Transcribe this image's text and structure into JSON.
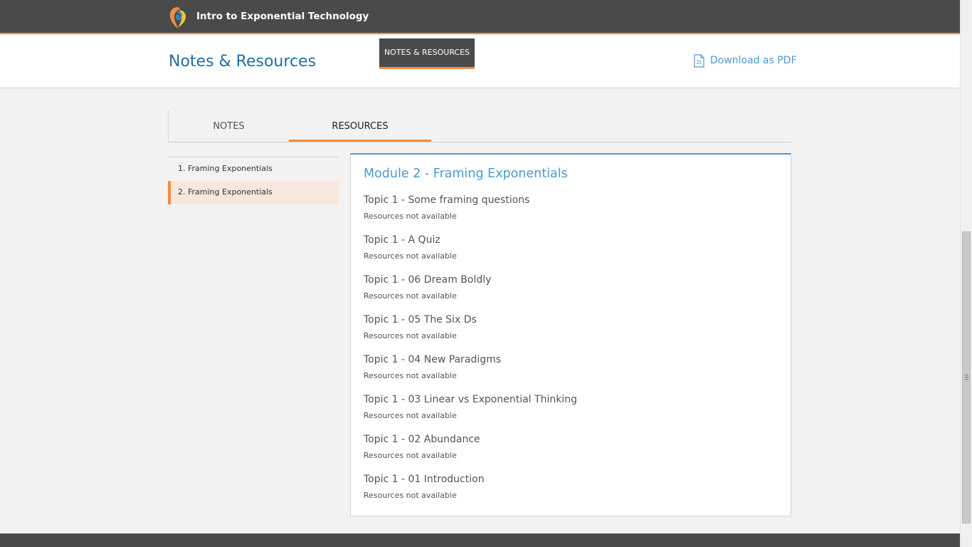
{
  "topbar": {
    "course_title": "Intro to Exponential Technology",
    "logo_icon": "brand-logo-icon",
    "accent_color": "#ef8d45",
    "bar_color": "#4a4a4a"
  },
  "header": {
    "page_title": "Notes & Resources",
    "nav_tab_label": "NOTES & RESOURCES",
    "download_label": "Download as PDF",
    "download_icon": "pdf-file-icon"
  },
  "tabs": [
    {
      "label": "NOTES",
      "active": false
    },
    {
      "label": "RESOURCES",
      "active": true
    }
  ],
  "sidebar": {
    "items": [
      {
        "label": "1. Framing Exponentials",
        "active": false
      },
      {
        "label": "2. Framing Exponentials",
        "active": true
      }
    ]
  },
  "panel": {
    "module_title": "Module 2 - Framing Exponentials",
    "topics": [
      {
        "title": "Topic 1 - Some framing questions",
        "status": "Resources not available"
      },
      {
        "title": "Topic 1 - A Quiz",
        "status": "Resources not available"
      },
      {
        "title": "Topic 1 - 06 Dream Boldly",
        "status": "Resources not available"
      },
      {
        "title": "Topic 1 - 05 The Six Ds",
        "status": "Resources not available"
      },
      {
        "title": "Topic 1 - 04 New Paradigms",
        "status": "Resources not available"
      },
      {
        "title": "Topic 1 - 03 Linear vs Exponential Thinking",
        "status": "Resources not available"
      },
      {
        "title": "Topic 1 - 02 Abundance",
        "status": "Resources not available"
      },
      {
        "title": "Topic 1 - 01 Introduction",
        "status": "Resources not available"
      }
    ]
  },
  "colors": {
    "link_blue": "#4b9ad0",
    "title_blue": "#1f6fa6",
    "active_item_bg": "#f7e7dc"
  }
}
